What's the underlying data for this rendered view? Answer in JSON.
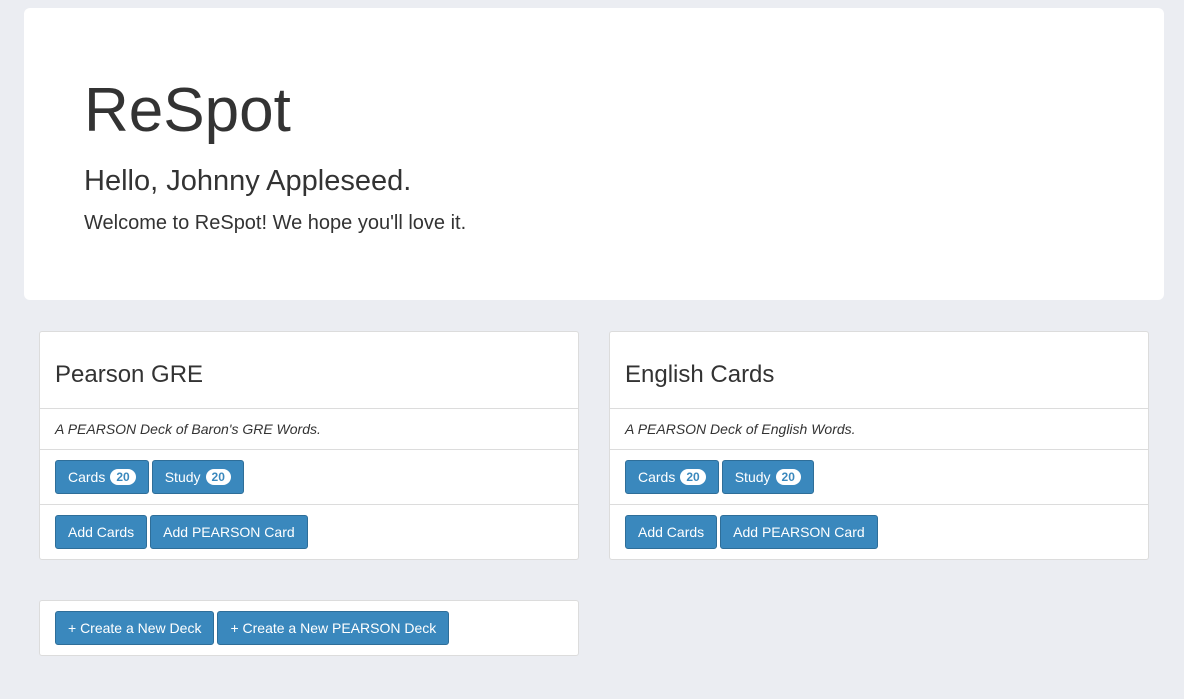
{
  "header": {
    "title": "ReSpot",
    "greeting": "Hello, Johnny Appleseed.",
    "welcome": "Welcome to ReSpot! We hope you'll love it."
  },
  "decks": [
    {
      "name": "Pearson GRE",
      "description": "A PEARSON Deck of Baron's GRE Words.",
      "cards_label": "Cards",
      "cards_count": "20",
      "study_label": "Study",
      "study_count": "20",
      "add_cards_label": "Add Cards",
      "add_pearson_label": "Add PEARSON Card"
    },
    {
      "name": "English Cards",
      "description": "A PEARSON Deck of English Words.",
      "cards_label": "Cards",
      "cards_count": "20",
      "study_label": "Study",
      "study_count": "20",
      "add_cards_label": "Add Cards",
      "add_pearson_label": "Add PEARSON Card"
    }
  ],
  "create": {
    "new_deck_label": "+ Create a New Deck",
    "new_pearson_deck_label": "+ Create a New PEARSON Deck"
  },
  "colors": {
    "page_background": "#ebedf2",
    "button": "#3a88bd",
    "button_border": "#2e6e99",
    "panel_border": "#dcdcdc"
  }
}
